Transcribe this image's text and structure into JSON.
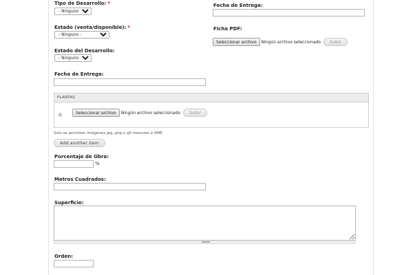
{
  "form": {
    "tipo_desarrollo": {
      "label": "Tipo de Desarrollo:",
      "required_mark": "*",
      "selected": "- Ninguno -"
    },
    "estado_venta": {
      "label": "Estado (venta/disponible):",
      "required_mark": "*",
      "selected": "- Ninguno -"
    },
    "estado_desarrollo": {
      "label": "Estado del Desarrollo:",
      "selected": "- Ninguno -"
    },
    "fecha_entrega_left": {
      "label": "Fecha de Entrega:",
      "value": ""
    },
    "fecha_entrega_right": {
      "label": "Fecha de Entrega:",
      "value": ""
    },
    "ficha_pdf": {
      "label": "Ficha PDF:",
      "choose_button": "Seleccionar archivo",
      "no_file_text": "Ningún archivo seleccionado",
      "upload_button": "Subir"
    },
    "plantas": {
      "header": "PLANTAS",
      "choose_button": "Seleccionar archivo",
      "no_file_text": "Ningún archivo seleccionado",
      "upload_button": "Subir",
      "help_text": "Solo se permiten imágenes jpg, png o gif menores a 4MB",
      "add_another_button": "Add another item"
    },
    "porcentaje_obra": {
      "label": "Porcentaje de Obra:",
      "value": "",
      "suffix": "%"
    },
    "metros_cuadrados": {
      "label": "Metros Cuadrados:",
      "value": ""
    },
    "superficie": {
      "label": "Superficie:",
      "value": ""
    },
    "orden": {
      "label": "Orden:",
      "value": ""
    }
  }
}
